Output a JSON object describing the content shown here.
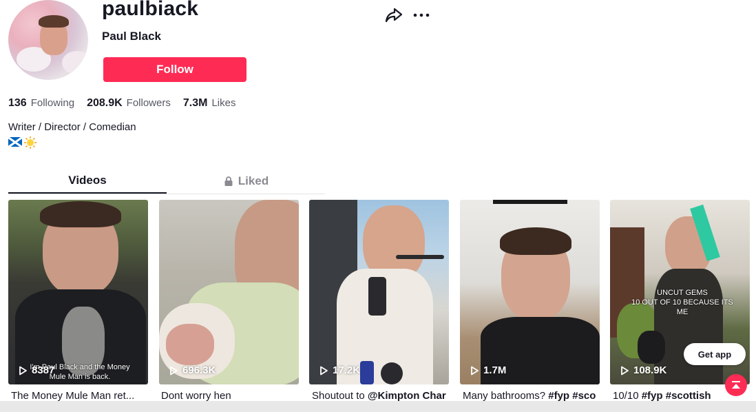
{
  "profile": {
    "username": "paulbiack",
    "nickname": "Paul Black",
    "follow_label": "Follow",
    "bio": "Writer / Director / Comedian"
  },
  "stats": [
    {
      "value": "136",
      "label": "Following"
    },
    {
      "value": "208.9K",
      "label": "Followers"
    },
    {
      "value": "7.3M",
      "label": "Likes"
    }
  ],
  "tabs": {
    "videos": "Videos",
    "liked": "Liked"
  },
  "videos": [
    {
      "views": "8387",
      "caption": "The Money Mule Man ret...",
      "overlay": "I'm Paul Black and the Money Mule Man is back."
    },
    {
      "views": "696.3K",
      "caption": "Dont worry hen"
    },
    {
      "views": "17.2K",
      "caption_prefix": "Shoutout to ",
      "caption_bold": "@Kimpton Char"
    },
    {
      "views": "1.7M",
      "caption_prefix": "Many bathrooms? ",
      "caption_bold": "#fyp #sco"
    },
    {
      "views": "108.9K",
      "caption_prefix": "10/10 ",
      "caption_bold": "#fyp #scottish",
      "overlay": "UNCUT GEMS\n10 OUT OF 10 BECAUSE ITS\nME"
    }
  ],
  "get_app_label": "Get app",
  "colors": {
    "accent": "#fe2c55",
    "text": "#161823",
    "secondary": "#555963"
  },
  "icons": [
    "share-icon",
    "more-icon",
    "lock-icon",
    "play-icon",
    "back-to-top-icon",
    "scotland-flag-icon",
    "sun-icon"
  ]
}
